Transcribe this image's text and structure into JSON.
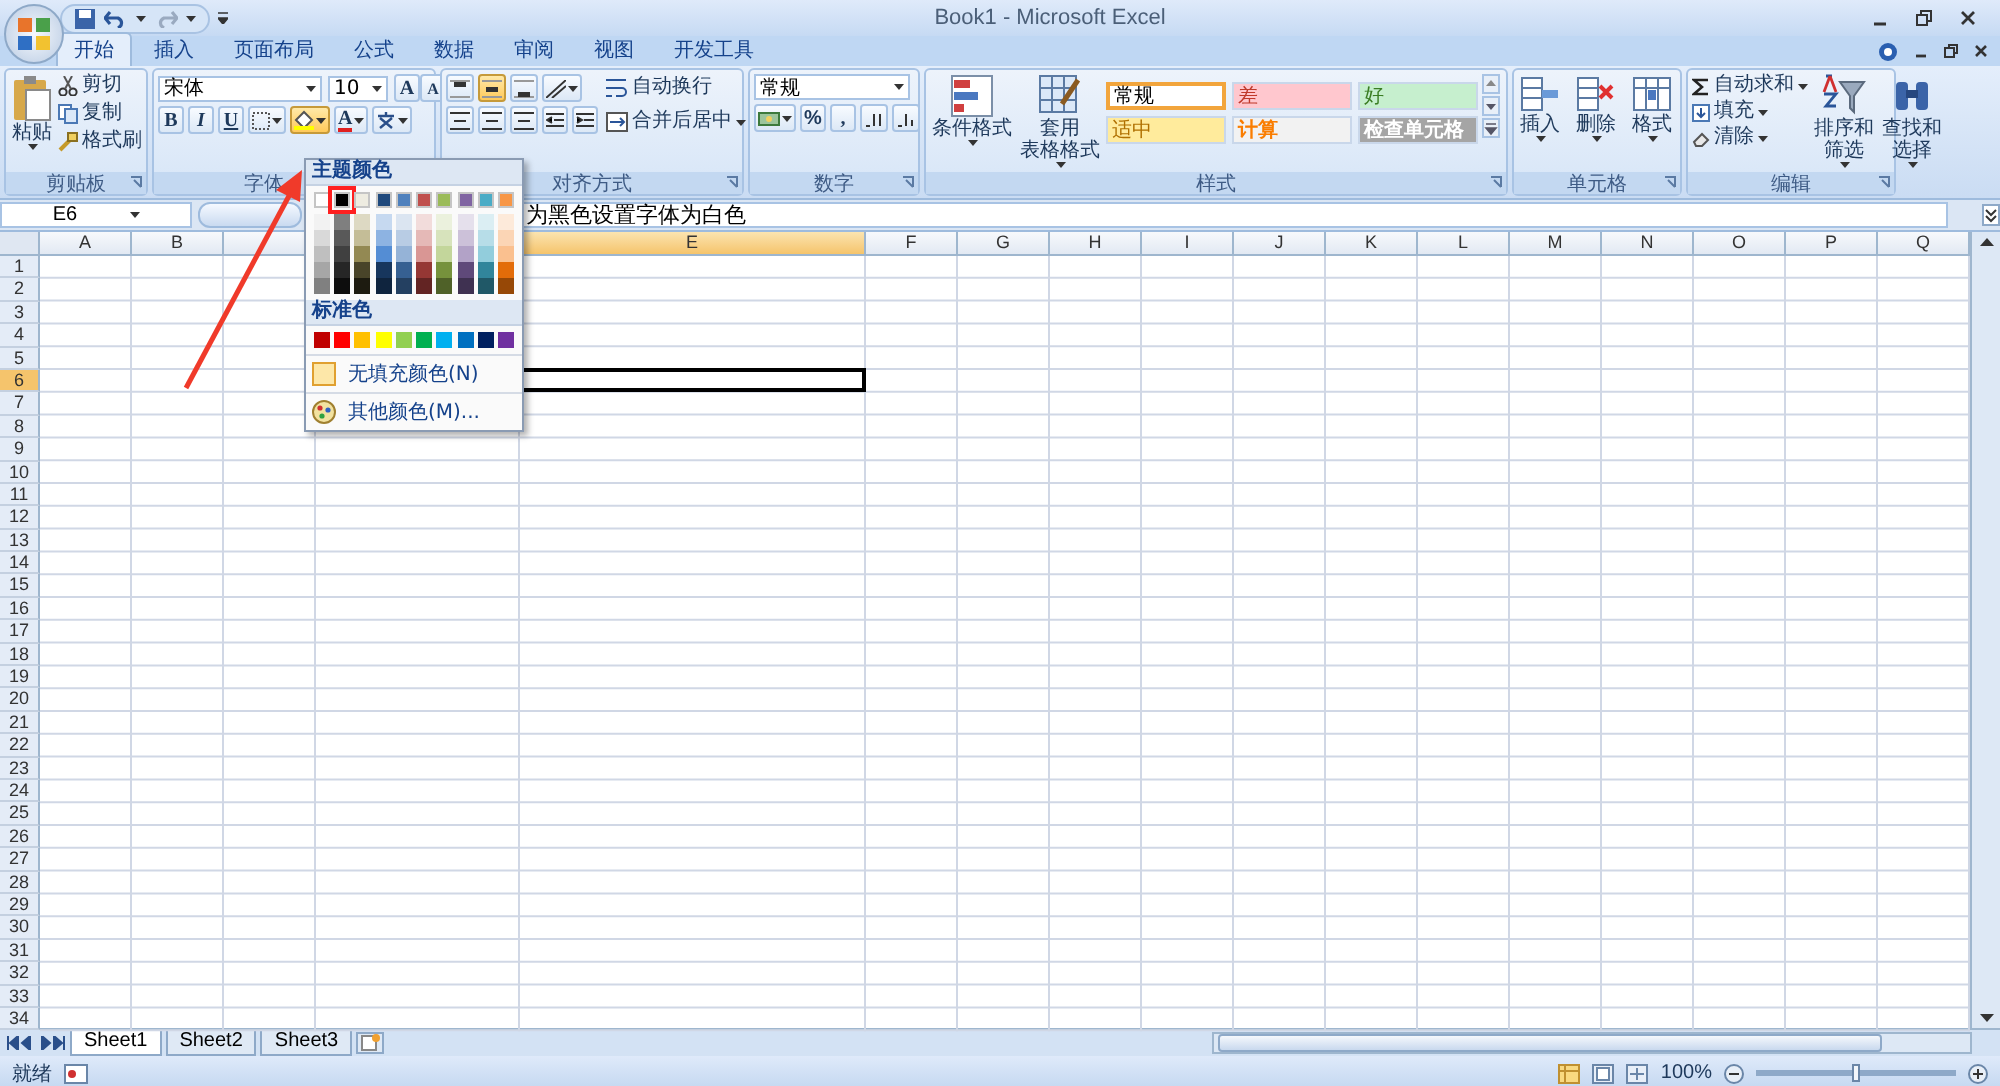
{
  "window": {
    "title": "Book1 - Microsoft Excel"
  },
  "tabs": [
    {
      "label": "开始",
      "selected": true
    },
    {
      "label": "插入",
      "selected": false
    },
    {
      "label": "页面布局",
      "selected": false
    },
    {
      "label": "公式",
      "selected": false
    },
    {
      "label": "数据",
      "selected": false
    },
    {
      "label": "审阅",
      "selected": false
    },
    {
      "label": "视图",
      "selected": false
    },
    {
      "label": "开发工具",
      "selected": false
    }
  ],
  "ribbon": {
    "clipboard": {
      "paste": "粘贴",
      "items": [
        "剪切",
        "复制",
        "格式刷"
      ],
      "title": "剪贴板"
    },
    "font": {
      "font_name": "宋体",
      "font_size": "10",
      "grow": "A",
      "shrink": "A",
      "styles": [
        "B",
        "I",
        "U"
      ],
      "font_color": "A",
      "title": "字体"
    },
    "alignment": {
      "wrap": "自动换行",
      "merge": "合并后居中",
      "title": "对齐方式"
    },
    "number": {
      "format": "常规",
      "percent": "%",
      "comma": ",",
      "title": "数字"
    },
    "styles": {
      "conditional": "条件格式",
      "table": [
        "套用",
        "表格格式"
      ],
      "title": "样式",
      "cell_styles": [
        {
          "label": "常规",
          "kind": "normal",
          "color": "#ffffff",
          "selected": true
        },
        {
          "label": "差",
          "kind": "bad",
          "color": "#ffc7ce",
          "selected": false
        },
        {
          "label": "好",
          "kind": "good",
          "color": "#c6efce",
          "selected": false
        },
        {
          "label": "适中",
          "kind": "neutral",
          "color": "#ffeb9c",
          "selected": false
        },
        {
          "label": "计算",
          "kind": "calculation",
          "color": "#f2f2f2",
          "selected": false
        },
        {
          "label": "检查单元格",
          "kind": "check",
          "color": "#a5a5a5",
          "selected": false
        }
      ]
    },
    "cells": {
      "buttons": [
        "插入",
        "删除",
        "格式"
      ],
      "title": "单元格"
    },
    "editing": {
      "items": [
        "自动求和",
        "填充",
        "清除"
      ],
      "sort": [
        "排序和",
        "筛选"
      ],
      "find": [
        "查找和",
        "选择"
      ],
      "title": "编辑"
    }
  },
  "formula_bar": {
    "name_box": "E6",
    "formula": "为黑色设置字体为白色"
  },
  "sheet": {
    "columns": [
      {
        "label": "A",
        "selected": false
      },
      {
        "label": "B",
        "selected": false
      },
      {
        "selected": false
      },
      {
        "label": "E",
        "selected": true
      },
      {
        "label": "F",
        "selected": false
      },
      {
        "label": "G",
        "selected": false
      },
      {
        "label": "H",
        "selected": false
      },
      {
        "label": "I",
        "selected": false
      },
      {
        "label": "J",
        "selected": false
      },
      {
        "label": "K",
        "selected": false
      },
      {
        "label": "L",
        "selected": false
      },
      {
        "label": "M",
        "selected": false
      },
      {
        "label": "N",
        "selected": false
      },
      {
        "label": "O",
        "selected": false
      },
      {
        "label": "P",
        "selected": false
      },
      {
        "label": "Q",
        "selected": false
      }
    ],
    "rows": [
      {
        "label": "1",
        "selected": false
      },
      {
        "label": "2",
        "selected": false
      },
      {
        "label": "3",
        "selected": false
      },
      {
        "label": "4",
        "selected": false
      },
      {
        "label": "5",
        "selected": false
      },
      {
        "label": "6",
        "selected": true
      },
      {
        "label": "7",
        "selected": false
      },
      {
        "label": "8",
        "selected": false
      },
      {
        "label": "9",
        "selected": false
      },
      {
        "label": "10",
        "selected": false
      },
      {
        "label": "11",
        "selected": false
      },
      {
        "label": "12",
        "selected": false
      },
      {
        "label": "13",
        "selected": false
      },
      {
        "label": "14",
        "selected": false
      },
      {
        "label": "15",
        "selected": false
      },
      {
        "label": "16",
        "selected": false
      },
      {
        "label": "17",
        "selected": false
      },
      {
        "label": "18",
        "selected": false
      },
      {
        "label": "19",
        "selected": false
      },
      {
        "label": "20",
        "selected": false
      },
      {
        "label": "21",
        "selected": false
      },
      {
        "label": "22",
        "selected": false
      },
      {
        "label": "23",
        "selected": false
      },
      {
        "label": "24",
        "selected": false
      },
      {
        "label": "25",
        "selected": false
      },
      {
        "label": "26",
        "selected": false
      },
      {
        "label": "27",
        "selected": false
      },
      {
        "label": "28",
        "selected": false
      },
      {
        "label": "29",
        "selected": false
      },
      {
        "label": "30",
        "selected": false
      },
      {
        "label": "31",
        "selected": false
      },
      {
        "label": "32",
        "selected": false
      },
      {
        "label": "33",
        "selected": false
      },
      {
        "label": "34",
        "selected": false
      }
    ]
  },
  "color_menu": {
    "theme_title": "主题颜色",
    "theme_colors": [
      {
        "color": "#ffffff",
        "selected": false
      },
      {
        "color": "#000000",
        "selected": true
      },
      {
        "color": "#eeece1",
        "selected": false
      },
      {
        "color": "#1f497d",
        "selected": false
      },
      {
        "color": "#4f81bd",
        "selected": false
      },
      {
        "color": "#c0504d",
        "selected": false
      },
      {
        "color": "#9bbb59",
        "selected": false
      },
      {
        "color": "#8064a2",
        "selected": false
      },
      {
        "color": "#4bacc6",
        "selected": false
      },
      {
        "color": "#f79646",
        "selected": false
      }
    ],
    "shades": [
      [
        {
          "color": "#f2f2f2"
        },
        {
          "color": "#7f7f7f"
        },
        {
          "color": "#ddd9c3"
        },
        {
          "color": "#c6d9f0"
        },
        {
          "color": "#dbe5f1"
        },
        {
          "color": "#f2dcdb"
        },
        {
          "color": "#ebf1dd"
        },
        {
          "color": "#e5e0ec"
        },
        {
          "color": "#dbeef3"
        },
        {
          "color": "#fdeada"
        }
      ],
      [
        {
          "color": "#d9d9d9"
        },
        {
          "color": "#595959"
        },
        {
          "color": "#c4bd97"
        },
        {
          "color": "#8db3e2"
        },
        {
          "color": "#b8cce4"
        },
        {
          "color": "#e5b9b7"
        },
        {
          "color": "#d7e3bc"
        },
        {
          "color": "#ccc1d9"
        },
        {
          "color": "#b7dde8"
        },
        {
          "color": "#fbd5b5"
        }
      ],
      [
        {
          "color": "#bfbfbf"
        },
        {
          "color": "#404040"
        },
        {
          "color": "#938953"
        },
        {
          "color": "#548dd4"
        },
        {
          "color": "#95b3d7"
        },
        {
          "color": "#d99694"
        },
        {
          "color": "#c3d69b"
        },
        {
          "color": "#b2a2c7"
        },
        {
          "color": "#92cddc"
        },
        {
          "color": "#fac08f"
        }
      ],
      [
        {
          "color": "#a6a6a6"
        },
        {
          "color": "#262626"
        },
        {
          "color": "#494429"
        },
        {
          "color": "#17365d"
        },
        {
          "color": "#366092"
        },
        {
          "color": "#953734"
        },
        {
          "color": "#76923c"
        },
        {
          "color": "#5f497a"
        },
        {
          "color": "#31859b"
        },
        {
          "color": "#e36c09"
        }
      ],
      [
        {
          "color": "#808080"
        },
        {
          "color": "#0d0d0d"
        },
        {
          "color": "#1d1b10"
        },
        {
          "color": "#0f243e"
        },
        {
          "color": "#244061"
        },
        {
          "color": "#632423"
        },
        {
          "color": "#4f6128"
        },
        {
          "color": "#3f3151"
        },
        {
          "color": "#205867"
        },
        {
          "color": "#974806"
        }
      ]
    ],
    "standard_title": "标准色",
    "standard_colors": [
      {
        "color": "#c00000"
      },
      {
        "color": "#ff0000"
      },
      {
        "color": "#ffc000"
      },
      {
        "color": "#ffff00"
      },
      {
        "color": "#92d050"
      },
      {
        "color": "#00b050"
      },
      {
        "color": "#00b0f0"
      },
      {
        "color": "#0070c0"
      },
      {
        "color": "#002060"
      },
      {
        "color": "#7030a0"
      }
    ],
    "items": [
      {
        "kind": "no-fill",
        "label": "无填充颜色(N)"
      },
      {
        "kind": "more",
        "label": "其他颜色(M)..."
      }
    ]
  },
  "sheet_tabs": [
    {
      "label": "Sheet1",
      "selected": true
    },
    {
      "label": "Sheet2",
      "selected": false
    },
    {
      "label": "Sheet3",
      "selected": false
    }
  ],
  "status_bar": {
    "status": "就绪",
    "zoom": "100%",
    "zoom_slider": {
      "level": 0.5
    }
  }
}
